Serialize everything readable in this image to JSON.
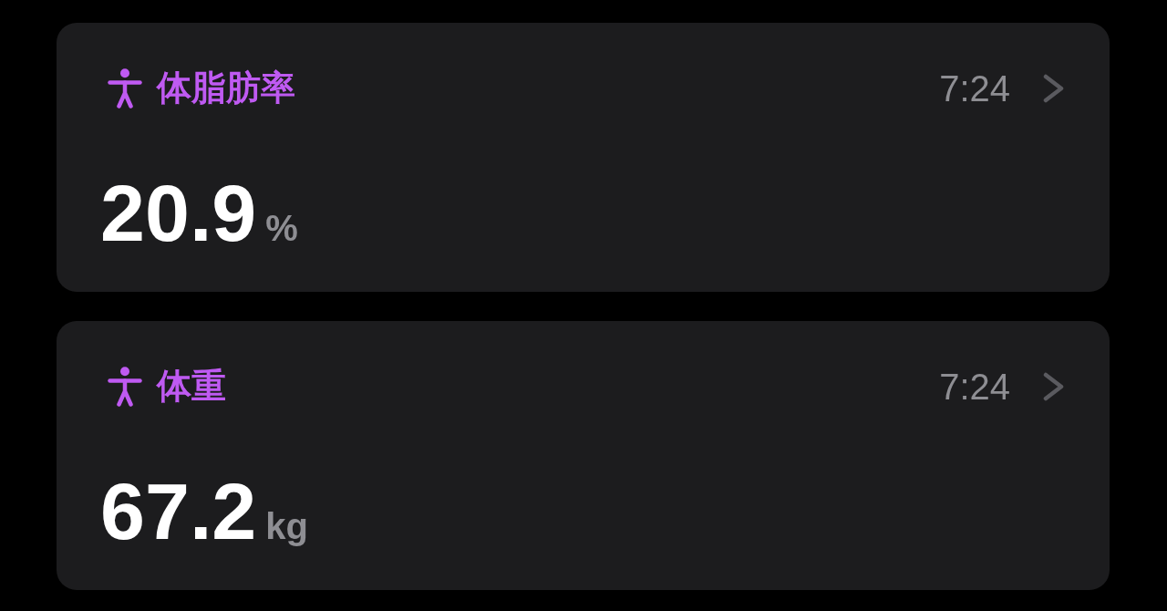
{
  "cards": [
    {
      "title": "体脂肪率",
      "time": "7:24",
      "value": "20.9",
      "unit": "%"
    },
    {
      "title": "体重",
      "time": "7:24",
      "value": "67.2",
      "unit": "kg"
    }
  ]
}
